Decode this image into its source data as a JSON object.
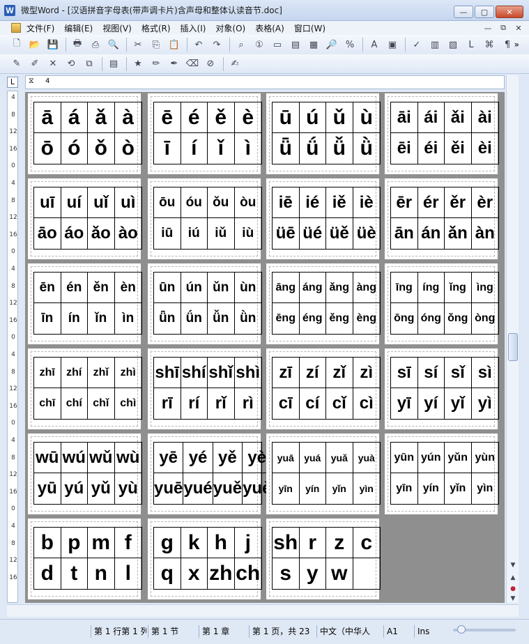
{
  "window": {
    "title": "微型Word - [汉语拼音字母表(带声调卡片)含声母和整体认读音节.doc]"
  },
  "menu": [
    "文件(F)",
    "编辑(E)",
    "视图(V)",
    "格式(R)",
    "插入(I)",
    "对象(O)",
    "表格(A)",
    "窗口(W)"
  ],
  "toolbar": {
    "more": "»"
  },
  "ruler": {
    "marker": "4",
    "vertical_marks": [
      "4",
      "8",
      "12",
      "16",
      "0",
      "4",
      "8",
      "12",
      "16",
      "0",
      "4",
      "8",
      "12",
      "16",
      "0",
      "4",
      "8",
      "12",
      "16",
      "0",
      "4",
      "8",
      "12",
      "16",
      "0",
      "4",
      "8",
      "12",
      "16"
    ]
  },
  "cards": [
    {
      "size": "big",
      "cells": [
        "ā",
        "á",
        "ǎ",
        "à",
        "ō",
        "ó",
        "ǒ",
        "ò"
      ]
    },
    {
      "size": "big",
      "cells": [
        "ē",
        "é",
        "ě",
        "è",
        "ī",
        "í",
        "ǐ",
        "ì"
      ]
    },
    {
      "size": "big",
      "cells": [
        "ū",
        "ú",
        "ǔ",
        "ù",
        "ǖ",
        "ǘ",
        "ǚ",
        "ǜ"
      ]
    },
    {
      "size": "mid",
      "cells": [
        "āi",
        "ái",
        "ǎi",
        "ài",
        "ēi",
        "éi",
        "ěi",
        "èi"
      ]
    },
    {
      "size": "mid",
      "cells": [
        "uī",
        "uí",
        "uǐ",
        "uì",
        "āo",
        "áo",
        "ǎo",
        "ào"
      ]
    },
    {
      "size": "sm",
      "cells": [
        "ōu",
        "óu",
        "ǒu",
        "òu",
        "iū",
        "iú",
        "iǔ",
        "iù"
      ]
    },
    {
      "size": "mid",
      "cells": [
        "iē",
        "ié",
        "iě",
        "iè",
        "üē",
        "üé",
        "üě",
        "üè"
      ]
    },
    {
      "size": "mid",
      "cells": [
        "ēr",
        "ér",
        "ěr",
        "èr",
        "ān",
        "án",
        "ǎn",
        "àn"
      ]
    },
    {
      "size": "sm",
      "cells": [
        "ēn",
        "én",
        "ěn",
        "èn",
        "īn",
        "ín",
        "ǐn",
        "ìn"
      ]
    },
    {
      "size": "sm",
      "cells": [
        "ūn",
        "ún",
        "ǔn",
        "ùn",
        "ǖn",
        "ǘn",
        "ǚn",
        "ǜn"
      ]
    },
    {
      "size": "xs",
      "cells": [
        "āng",
        "áng",
        "ǎng",
        "àng",
        "ēng",
        "éng",
        "ěng",
        "èng"
      ]
    },
    {
      "size": "xs",
      "cells": [
        "īng",
        "íng",
        "ǐng",
        "ìng",
        "ōng",
        "óng",
        "ǒng",
        "òng"
      ]
    },
    {
      "size": "xs",
      "cells": [
        "zhī",
        "zhí",
        "zhǐ",
        "zhì",
        "chī",
        "chí",
        "chǐ",
        "chì"
      ]
    },
    {
      "size": "mid",
      "cells": [
        "shī",
        "shí",
        "shǐ",
        "shì",
        "rī",
        "rí",
        "rǐ",
        "rì"
      ]
    },
    {
      "size": "mid",
      "cells": [
        "zī",
        "zí",
        "zǐ",
        "zì",
        "cī",
        "cí",
        "cǐ",
        "cì"
      ]
    },
    {
      "size": "mid",
      "cells": [
        "sī",
        "sí",
        "sǐ",
        "sì",
        "yī",
        "yí",
        "yǐ",
        "yì"
      ]
    },
    {
      "size": "mid",
      "cells": [
        "wū",
        "wú",
        "wǔ",
        "wù",
        "yū",
        "yú",
        "yǔ",
        "yù"
      ]
    },
    {
      "size": "mid",
      "cells": [
        "yē",
        "yé",
        "yě",
        "yè",
        "yuē",
        "yué",
        "yuě",
        "yuè"
      ]
    },
    {
      "size": "xxs",
      "cells": [
        "yuā",
        "yuá",
        "yuǎ",
        "yuà",
        "yīn",
        "yín",
        "yǐn",
        "yìn"
      ]
    },
    {
      "size": "xs",
      "cells": [
        "yūn",
        "yún",
        "yǔn",
        "yùn",
        "yīn",
        "yín",
        "yǐn",
        "yìn"
      ]
    },
    {
      "size": "big",
      "cells": [
        "b",
        "p",
        "m",
        "f",
        "d",
        "t",
        "n",
        "l"
      ]
    },
    {
      "size": "big",
      "cells": [
        "g",
        "k",
        "h",
        "j",
        "q",
        "x",
        "zh",
        "ch"
      ]
    },
    {
      "size": "big",
      "cells": [
        "sh",
        "r",
        "z",
        "c",
        "s",
        "y",
        "w",
        ""
      ]
    }
  ],
  "status": {
    "line_col": "第 1 行第 1 列",
    "section": "第 1 节",
    "chapter": "第 1 章",
    "page": "第 1 页，共 23",
    "language": "中文（中华人",
    "a1": "A1",
    "ins": "Ins"
  }
}
